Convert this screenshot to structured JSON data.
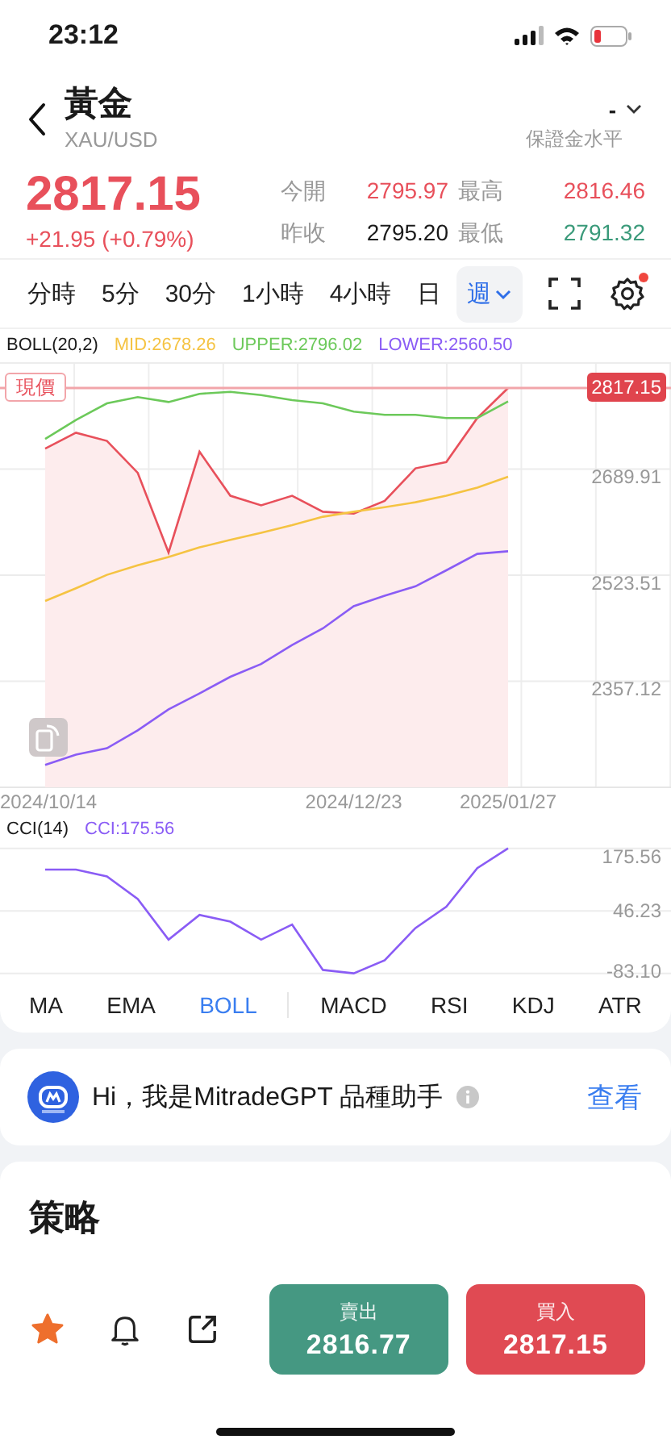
{
  "status_bar": {
    "time": "23:12"
  },
  "header": {
    "title": "黃金",
    "subtitle": "XAU/USD",
    "margin": {
      "value": "-",
      "label": "保證金水平"
    }
  },
  "quote": {
    "price": "2817.15",
    "change": "+21.95 (+0.79%)",
    "stats": [
      {
        "label": "今開",
        "value": "2795.97",
        "color": "#e8505b"
      },
      {
        "label": "最高",
        "value": "2816.46",
        "color": "#e8505b"
      },
      {
        "label": "昨收",
        "value": "2795.20",
        "color": "#1a1a1a"
      },
      {
        "label": "最低",
        "value": "2791.32",
        "color": "#3a9a7a"
      }
    ]
  },
  "timeframes": [
    {
      "label": "分時",
      "selected": false,
      "dropdown": false
    },
    {
      "label": "5分",
      "selected": false,
      "dropdown": false
    },
    {
      "label": "30分",
      "selected": false,
      "dropdown": false
    },
    {
      "label": "1小時",
      "selected": false,
      "dropdown": false
    },
    {
      "label": "4小時",
      "selected": false,
      "dropdown": false
    },
    {
      "label": "日",
      "selected": false,
      "dropdown": false
    },
    {
      "label": "週",
      "selected": true,
      "dropdown": true
    }
  ],
  "settings": {
    "badge": true
  },
  "main_chart": {
    "legend": [
      {
        "text": "BOLL(20,2)",
        "color": "#1a1a1a"
      },
      {
        "text": "MID:2678.26",
        "color": "#f5c342"
      },
      {
        "text": "UPPER:2796.02",
        "color": "#6cc95a"
      },
      {
        "text": "LOWER:2560.50",
        "color": "#8a5cf5"
      }
    ],
    "current_price": {
      "label": "現價",
      "value": "2817.15"
    },
    "chart_data": {
      "type": "line",
      "grid": true,
      "categories": [
        "2024/10/14",
        null,
        null,
        null,
        null,
        null,
        null,
        null,
        null,
        null,
        "2024/12/23",
        null,
        null,
        null,
        null,
        "2025/01/27"
      ],
      "ylim": [
        2190.7,
        2856.3
      ],
      "yticks": [
        {
          "value": 2689.91,
          "label": "2689.91"
        },
        {
          "value": 2523.51,
          "label": "2523.51"
        },
        {
          "value": 2357.12,
          "label": "2357.12"
        }
      ],
      "ref_lines": [
        {
          "axis": "y",
          "value": 2817.15,
          "color": "#f2a5aa"
        }
      ],
      "series": [
        {
          "type": "area",
          "color": "#e8505b",
          "values": [
            2722,
            2747,
            2734,
            2684,
            2559,
            2717,
            2648,
            2633,
            2648,
            2623,
            2620,
            2640,
            2691,
            2701,
            2770,
            2817
          ]
        },
        {
          "color": "#6cc95a",
          "values": [
            2737,
            2767,
            2793,
            2803,
            2795,
            2808,
            2811,
            2806,
            2798,
            2793,
            2780,
            2775,
            2775,
            2770,
            2770,
            2796
          ]
        },
        {
          "color": "#f5c342",
          "values": [
            2483,
            2503,
            2524,
            2539,
            2552,
            2567,
            2579,
            2590,
            2602,
            2615,
            2623,
            2630,
            2638,
            2648,
            2661,
            2678
          ]
        },
        {
          "color": "#8a5cf5",
          "values": [
            2226,
            2242,
            2252,
            2280,
            2313,
            2338,
            2364,
            2384,
            2414,
            2440,
            2475,
            2491,
            2506,
            2531,
            2557,
            2561
          ]
        }
      ]
    }
  },
  "cci_chart": {
    "legend": [
      {
        "text": "CCI(14)",
        "color": "#1a1a1a"
      },
      {
        "text": "CCI:175.56",
        "color": "#8a5cf5"
      }
    ],
    "chart_data": {
      "type": "line",
      "categories": [
        null,
        null,
        null,
        null,
        null,
        null,
        null,
        null,
        null,
        null,
        null,
        null,
        null,
        null,
        null,
        null
      ],
      "ylim": [
        -92,
        182
      ],
      "yticks": [
        {
          "value": 175.56,
          "label": "175.56"
        },
        {
          "value": 46.23,
          "label": "46.23"
        },
        {
          "value": -83.1,
          "label": "-83.10"
        }
      ],
      "series": [
        {
          "color": "#8a5cf5",
          "values": [
            132,
            132,
            118,
            71,
            -13,
            38,
            24,
            -13,
            18,
            -76,
            -83,
            -56,
            11,
            55,
            135,
            176
          ]
        }
      ]
    }
  },
  "indicators": [
    {
      "label": "MA",
      "selected": false,
      "divider_after": false
    },
    {
      "label": "EMA",
      "selected": false,
      "divider_after": false
    },
    {
      "label": "BOLL",
      "selected": true,
      "divider_after": true
    },
    {
      "label": "MACD",
      "selected": false,
      "divider_after": false
    },
    {
      "label": "RSI",
      "selected": false,
      "divider_after": false
    },
    {
      "label": "KDJ",
      "selected": false,
      "divider_after": false
    },
    {
      "label": "ATR",
      "selected": false,
      "divider_after": false
    }
  ],
  "assistant": {
    "text": "Hi，我是MitradeGPT 品種助手",
    "link": "查看"
  },
  "strategy": {
    "title": "策略"
  },
  "bottom_bar": {
    "favorite": true,
    "sell": {
      "label": "賣出",
      "price": "2816.77"
    },
    "buy": {
      "label": "買入",
      "price": "2817.15"
    }
  }
}
